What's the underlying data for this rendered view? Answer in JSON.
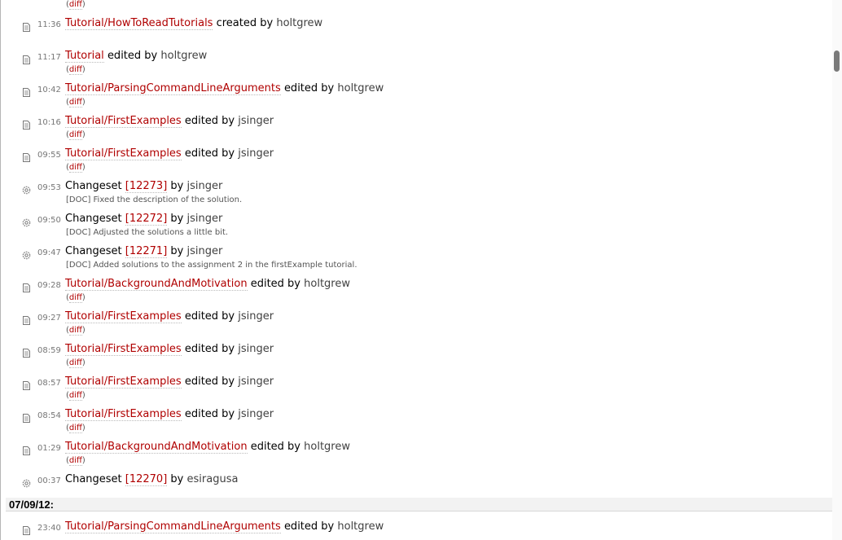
{
  "top_partial": {
    "diff_label": "diff"
  },
  "entries": [
    {
      "kind": "wiki",
      "time": "11:36",
      "page": "Tutorial/HowToReadTutorials",
      "action": "created by",
      "author": "holtgrew",
      "diff_label": ""
    },
    {
      "kind": "wiki",
      "time": "11:17",
      "page": "Tutorial",
      "action": "edited by",
      "author": "holtgrew",
      "diff_label": "diff"
    },
    {
      "kind": "wiki",
      "time": "10:42",
      "page": "Tutorial/ParsingCommandLineArguments",
      "action": "edited by",
      "author": "holtgrew",
      "diff_label": "diff"
    },
    {
      "kind": "wiki",
      "time": "10:16",
      "page": "Tutorial/FirstExamples",
      "action": "edited by",
      "author": "jsinger",
      "diff_label": "diff"
    },
    {
      "kind": "wiki",
      "time": "09:55",
      "page": "Tutorial/FirstExamples",
      "action": "edited by",
      "author": "jsinger",
      "diff_label": "diff"
    },
    {
      "kind": "changeset",
      "time": "09:53",
      "prefix": "Changeset",
      "rev": "[12273]",
      "action": "by",
      "author": "jsinger",
      "message": "[DOC] Fixed the description of the solution."
    },
    {
      "kind": "changeset",
      "time": "09:50",
      "prefix": "Changeset",
      "rev": "[12272]",
      "action": "by",
      "author": "jsinger",
      "message": "[DOC] Adjusted the solutions a little bit."
    },
    {
      "kind": "changeset",
      "time": "09:47",
      "prefix": "Changeset",
      "rev": "[12271]",
      "action": "by",
      "author": "jsinger",
      "message": "[DOC] Added solutions to the assignment 2 in the firstExample tutorial."
    },
    {
      "kind": "wiki",
      "time": "09:28",
      "page": "Tutorial/BackgroundAndMotivation",
      "action": "edited by",
      "author": "holtgrew",
      "diff_label": "diff"
    },
    {
      "kind": "wiki",
      "time": "09:27",
      "page": "Tutorial/FirstExamples",
      "action": "edited by",
      "author": "jsinger",
      "diff_label": "diff"
    },
    {
      "kind": "wiki",
      "time": "08:59",
      "page": "Tutorial/FirstExamples",
      "action": "edited by",
      "author": "jsinger",
      "diff_label": "diff"
    },
    {
      "kind": "wiki",
      "time": "08:57",
      "page": "Tutorial/FirstExamples",
      "action": "edited by",
      "author": "jsinger",
      "diff_label": "diff"
    },
    {
      "kind": "wiki",
      "time": "08:54",
      "page": "Tutorial/FirstExamples",
      "action": "edited by",
      "author": "jsinger",
      "diff_label": "diff"
    },
    {
      "kind": "wiki",
      "time": "01:29",
      "page": "Tutorial/BackgroundAndMotivation",
      "action": "edited by",
      "author": "holtgrew",
      "diff_label": "diff"
    },
    {
      "kind": "changeset",
      "time": "00:37",
      "prefix": "Changeset",
      "rev": "[12270]",
      "action": "by",
      "author": "esiragusa",
      "message": ""
    }
  ],
  "day_header": "07/09/12:",
  "next_day_entries": [
    {
      "kind": "wiki",
      "time": "23:40",
      "page": "Tutorial/ParsingCommandLineArguments",
      "action": "edited by",
      "author": "holtgrew",
      "diff_label": ""
    }
  ],
  "colors": {
    "link": "#b00000",
    "meta": "#767676",
    "header_bg": "#f2f2f2"
  }
}
